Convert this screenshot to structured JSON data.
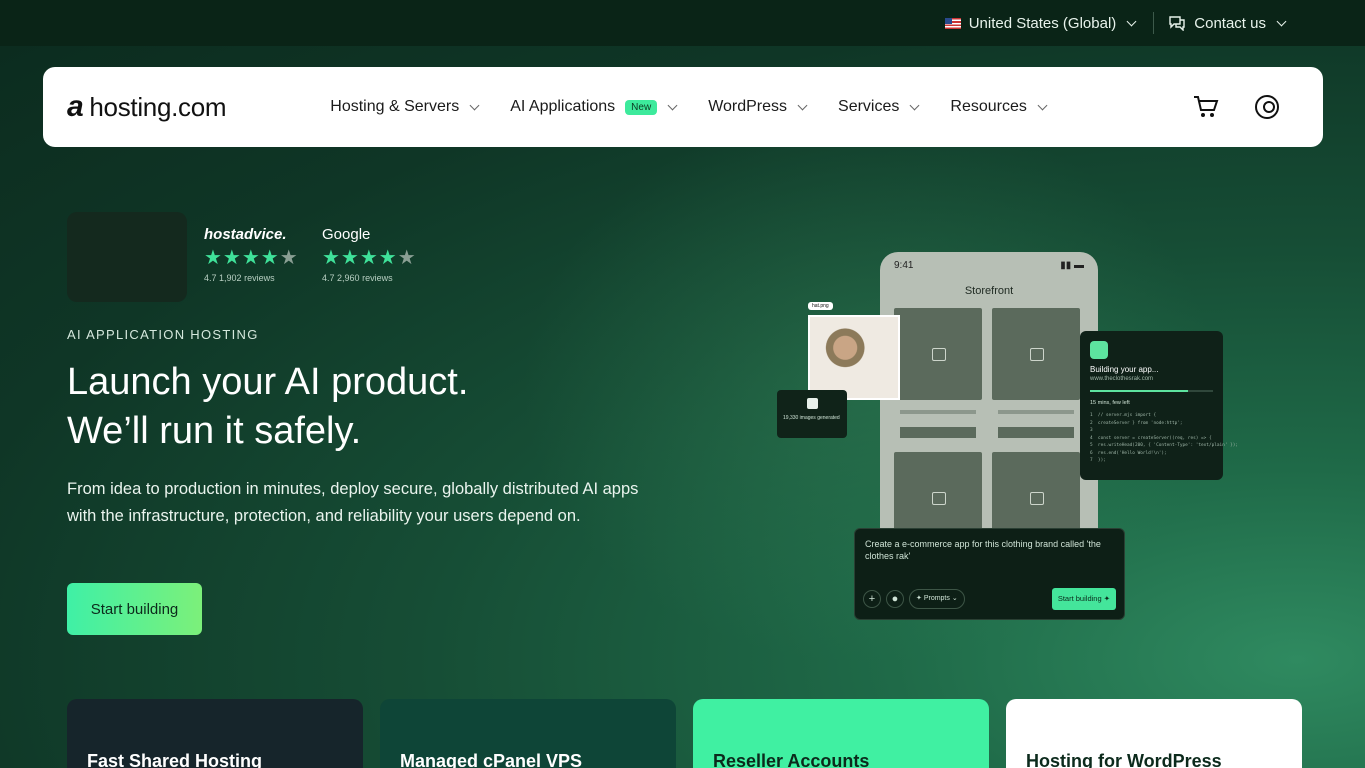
{
  "topbar": {
    "region": "United States (Global)",
    "contact": "Contact us"
  },
  "nav": {
    "brand": "hosting.com",
    "menu": [
      {
        "label": "Hosting & Servers"
      },
      {
        "label": "AI Applications",
        "badge": "New"
      },
      {
        "label": "WordPress"
      },
      {
        "label": "Services"
      },
      {
        "label": "Resources"
      }
    ]
  },
  "ratings": [
    {
      "brand": "hostadvice.",
      "score": "4.7",
      "reviews": "1,902",
      "reviews_word": "reviews"
    },
    {
      "brand": "Google",
      "score": "4.7",
      "reviews": "2,960",
      "reviews_word": "reviews"
    }
  ],
  "hero": {
    "eyebrow": "AI APPLICATION HOSTING",
    "title_line1": "Launch your AI product.",
    "title_line2": "We’ll run it safely.",
    "subtitle": "From idea to production in minutes, deploy secure, globally distributed AI apps with the infrastructure, protection, and reliability your users depend on.",
    "cta": "Start building"
  },
  "mockup": {
    "phone_time": "9:41",
    "phone_title": "Storefront",
    "photo_tag": "hat.png",
    "generated": "19,330 images generated",
    "build_title": "Building your app...",
    "build_url": "www.theclothesrak.com",
    "build_time": "15 mins, few left",
    "code": "1  // server.mjs import {\n2  createServer } from 'node:http';\n3\n4  const server = createServer((req, res) => {\n5  res.writeHead(200, { 'Content-Type': 'text/plain' });\n6  res.end('Hello World!\\n');\n7  });",
    "prompt_text": "Create a e-commerce app for this clothing brand called 'the clothes rak'",
    "prompts_label": "Prompts",
    "start_label": "Start building"
  },
  "cards": [
    {
      "title": "Fast Shared Hosting",
      "bg": "#16252b",
      "fg": "#ffffff"
    },
    {
      "title": "Managed cPanel VPS",
      "bg": "#0e4537",
      "fg": "#ffffff"
    },
    {
      "title": "Reseller Accounts",
      "bg": "#40f0a2",
      "fg": "#0c2a1c"
    },
    {
      "title": "Hosting for WordPress",
      "bg": "#ffffff",
      "fg": "#0c2a1c"
    }
  ]
}
